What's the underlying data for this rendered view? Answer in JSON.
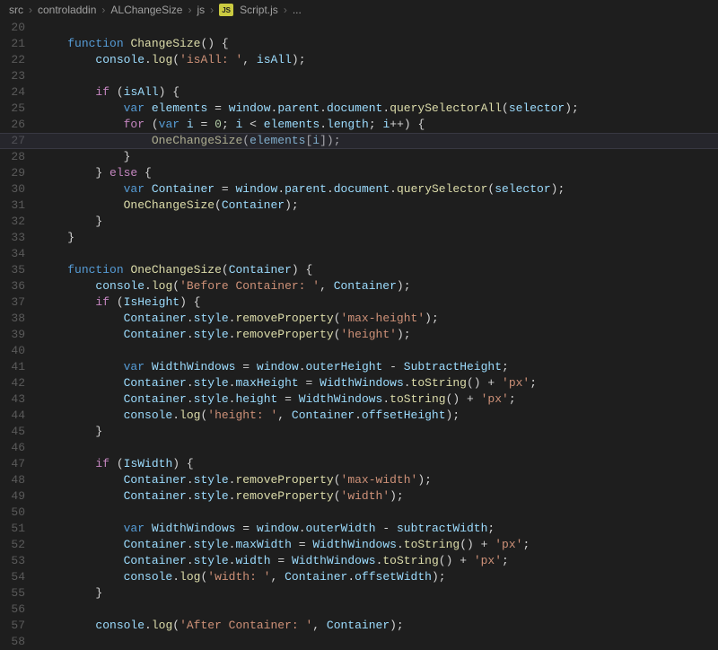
{
  "breadcrumb": {
    "parts": [
      "src",
      "controladdin",
      "ALChangeSize",
      "js"
    ],
    "filename": "Script.js",
    "tail": "...",
    "js_badge": "JS"
  },
  "editor": {
    "first_line": 20,
    "active_line": 27,
    "lines": [
      {
        "n": 20,
        "ind": 0,
        "t": []
      },
      {
        "n": 21,
        "ind": 1,
        "t": [
          [
            "kw",
            "function"
          ],
          [
            "sp",
            " "
          ],
          [
            "fn",
            "ChangeSize"
          ],
          [
            "pun",
            "() {"
          ]
        ]
      },
      {
        "n": 22,
        "ind": 2,
        "t": [
          [
            "var",
            "console"
          ],
          [
            "pun",
            "."
          ],
          [
            "fn",
            "log"
          ],
          [
            "pun",
            "("
          ],
          [
            "str",
            "'isAll: '"
          ],
          [
            "pun",
            ", "
          ],
          [
            "var",
            "isAll"
          ],
          [
            "pun",
            ");"
          ]
        ]
      },
      {
        "n": 23,
        "ind": 0,
        "t": []
      },
      {
        "n": 24,
        "ind": 2,
        "t": [
          [
            "ctrl",
            "if"
          ],
          [
            "sp",
            " "
          ],
          [
            "pun",
            "("
          ],
          [
            "var",
            "isAll"
          ],
          [
            "pun",
            ") {"
          ]
        ]
      },
      {
        "n": 25,
        "ind": 3,
        "t": [
          [
            "kw",
            "var"
          ],
          [
            "sp",
            " "
          ],
          [
            "var",
            "elements"
          ],
          [
            "sp",
            " "
          ],
          [
            "op",
            "="
          ],
          [
            "sp",
            " "
          ],
          [
            "var",
            "window"
          ],
          [
            "pun",
            "."
          ],
          [
            "prop",
            "parent"
          ],
          [
            "pun",
            "."
          ],
          [
            "prop",
            "document"
          ],
          [
            "pun",
            "."
          ],
          [
            "fn",
            "querySelectorAll"
          ],
          [
            "pun",
            "("
          ],
          [
            "var",
            "selector"
          ],
          [
            "pun",
            ");"
          ]
        ]
      },
      {
        "n": 26,
        "ind": 3,
        "t": [
          [
            "ctrl",
            "for"
          ],
          [
            "sp",
            " "
          ],
          [
            "pun",
            "("
          ],
          [
            "kw",
            "var"
          ],
          [
            "sp",
            " "
          ],
          [
            "var",
            "i"
          ],
          [
            "sp",
            " "
          ],
          [
            "op",
            "="
          ],
          [
            "sp",
            " "
          ],
          [
            "num",
            "0"
          ],
          [
            "pun",
            "; "
          ],
          [
            "var",
            "i"
          ],
          [
            "sp",
            " "
          ],
          [
            "op",
            "<"
          ],
          [
            "sp",
            " "
          ],
          [
            "var",
            "elements"
          ],
          [
            "pun",
            "."
          ],
          [
            "prop",
            "length"
          ],
          [
            "pun",
            "; "
          ],
          [
            "var",
            "i"
          ],
          [
            "op",
            "++"
          ],
          [
            "pun",
            ") {"
          ]
        ]
      },
      {
        "n": 27,
        "ind": 4,
        "t": [
          [
            "fn",
            "OneChangeSize"
          ],
          [
            "pun",
            "("
          ],
          [
            "var",
            "elements"
          ],
          [
            "pun",
            "["
          ],
          [
            "var",
            "i"
          ],
          [
            "pun",
            "]);"
          ]
        ]
      },
      {
        "n": 28,
        "ind": 3,
        "t": [
          [
            "pun",
            "}"
          ]
        ]
      },
      {
        "n": 29,
        "ind": 2,
        "t": [
          [
            "pun",
            "} "
          ],
          [
            "ctrl",
            "else"
          ],
          [
            "pun",
            " {"
          ]
        ]
      },
      {
        "n": 30,
        "ind": 3,
        "t": [
          [
            "kw",
            "var"
          ],
          [
            "sp",
            " "
          ],
          [
            "var",
            "Container"
          ],
          [
            "sp",
            " "
          ],
          [
            "op",
            "="
          ],
          [
            "sp",
            " "
          ],
          [
            "var",
            "window"
          ],
          [
            "pun",
            "."
          ],
          [
            "prop",
            "parent"
          ],
          [
            "pun",
            "."
          ],
          [
            "prop",
            "document"
          ],
          [
            "pun",
            "."
          ],
          [
            "fn",
            "querySelector"
          ],
          [
            "pun",
            "("
          ],
          [
            "var",
            "selector"
          ],
          [
            "pun",
            ");"
          ]
        ]
      },
      {
        "n": 31,
        "ind": 3,
        "t": [
          [
            "fn",
            "OneChangeSize"
          ],
          [
            "pun",
            "("
          ],
          [
            "var",
            "Container"
          ],
          [
            "pun",
            ");"
          ]
        ]
      },
      {
        "n": 32,
        "ind": 2,
        "t": [
          [
            "pun",
            "}"
          ]
        ]
      },
      {
        "n": 33,
        "ind": 1,
        "t": [
          [
            "pun",
            "}"
          ]
        ]
      },
      {
        "n": 34,
        "ind": 0,
        "t": []
      },
      {
        "n": 35,
        "ind": 1,
        "t": [
          [
            "kw",
            "function"
          ],
          [
            "sp",
            " "
          ],
          [
            "fn",
            "OneChangeSize"
          ],
          [
            "pun",
            "("
          ],
          [
            "var",
            "Container"
          ],
          [
            "pun",
            ") {"
          ]
        ]
      },
      {
        "n": 36,
        "ind": 2,
        "t": [
          [
            "var",
            "console"
          ],
          [
            "pun",
            "."
          ],
          [
            "fn",
            "log"
          ],
          [
            "pun",
            "("
          ],
          [
            "str",
            "'Before Container: '"
          ],
          [
            "pun",
            ", "
          ],
          [
            "var",
            "Container"
          ],
          [
            "pun",
            ");"
          ]
        ]
      },
      {
        "n": 37,
        "ind": 2,
        "t": [
          [
            "ctrl",
            "if"
          ],
          [
            "sp",
            " "
          ],
          [
            "pun",
            "("
          ],
          [
            "var",
            "IsHeight"
          ],
          [
            "pun",
            ") {"
          ]
        ]
      },
      {
        "n": 38,
        "ind": 3,
        "t": [
          [
            "var",
            "Container"
          ],
          [
            "pun",
            "."
          ],
          [
            "prop",
            "style"
          ],
          [
            "pun",
            "."
          ],
          [
            "fn",
            "removeProperty"
          ],
          [
            "pun",
            "("
          ],
          [
            "str",
            "'max-height'"
          ],
          [
            "pun",
            ");"
          ]
        ]
      },
      {
        "n": 39,
        "ind": 3,
        "t": [
          [
            "var",
            "Container"
          ],
          [
            "pun",
            "."
          ],
          [
            "prop",
            "style"
          ],
          [
            "pun",
            "."
          ],
          [
            "fn",
            "removeProperty"
          ],
          [
            "pun",
            "("
          ],
          [
            "str",
            "'height'"
          ],
          [
            "pun",
            ");"
          ]
        ]
      },
      {
        "n": 40,
        "ind": 0,
        "t": []
      },
      {
        "n": 41,
        "ind": 3,
        "t": [
          [
            "kw",
            "var"
          ],
          [
            "sp",
            " "
          ],
          [
            "var",
            "WidthWindows"
          ],
          [
            "sp",
            " "
          ],
          [
            "op",
            "="
          ],
          [
            "sp",
            " "
          ],
          [
            "var",
            "window"
          ],
          [
            "pun",
            "."
          ],
          [
            "prop",
            "outerHeight"
          ],
          [
            "sp",
            " "
          ],
          [
            "op",
            "-"
          ],
          [
            "sp",
            " "
          ],
          [
            "var",
            "SubtractHeight"
          ],
          [
            "pun",
            ";"
          ]
        ]
      },
      {
        "n": 42,
        "ind": 3,
        "t": [
          [
            "var",
            "Container"
          ],
          [
            "pun",
            "."
          ],
          [
            "prop",
            "style"
          ],
          [
            "pun",
            "."
          ],
          [
            "prop",
            "maxHeight"
          ],
          [
            "sp",
            " "
          ],
          [
            "op",
            "="
          ],
          [
            "sp",
            " "
          ],
          [
            "var",
            "WidthWindows"
          ],
          [
            "pun",
            "."
          ],
          [
            "fn",
            "toString"
          ],
          [
            "pun",
            "() "
          ],
          [
            "op",
            "+"
          ],
          [
            "sp",
            " "
          ],
          [
            "str",
            "'px'"
          ],
          [
            "pun",
            ";"
          ]
        ]
      },
      {
        "n": 43,
        "ind": 3,
        "t": [
          [
            "var",
            "Container"
          ],
          [
            "pun",
            "."
          ],
          [
            "prop",
            "style"
          ],
          [
            "pun",
            "."
          ],
          [
            "prop",
            "height"
          ],
          [
            "sp",
            " "
          ],
          [
            "op",
            "="
          ],
          [
            "sp",
            " "
          ],
          [
            "var",
            "WidthWindows"
          ],
          [
            "pun",
            "."
          ],
          [
            "fn",
            "toString"
          ],
          [
            "pun",
            "() "
          ],
          [
            "op",
            "+"
          ],
          [
            "sp",
            " "
          ],
          [
            "str",
            "'px'"
          ],
          [
            "pun",
            ";"
          ]
        ]
      },
      {
        "n": 44,
        "ind": 3,
        "t": [
          [
            "var",
            "console"
          ],
          [
            "pun",
            "."
          ],
          [
            "fn",
            "log"
          ],
          [
            "pun",
            "("
          ],
          [
            "str",
            "'height: '"
          ],
          [
            "pun",
            ", "
          ],
          [
            "var",
            "Container"
          ],
          [
            "pun",
            "."
          ],
          [
            "prop",
            "offsetHeight"
          ],
          [
            "pun",
            ");"
          ]
        ]
      },
      {
        "n": 45,
        "ind": 2,
        "t": [
          [
            "pun",
            "}"
          ]
        ]
      },
      {
        "n": 46,
        "ind": 0,
        "t": []
      },
      {
        "n": 47,
        "ind": 2,
        "t": [
          [
            "ctrl",
            "if"
          ],
          [
            "sp",
            " "
          ],
          [
            "pun",
            "("
          ],
          [
            "var",
            "IsWidth"
          ],
          [
            "pun",
            ") {"
          ]
        ]
      },
      {
        "n": 48,
        "ind": 3,
        "t": [
          [
            "var",
            "Container"
          ],
          [
            "pun",
            "."
          ],
          [
            "prop",
            "style"
          ],
          [
            "pun",
            "."
          ],
          [
            "fn",
            "removeProperty"
          ],
          [
            "pun",
            "("
          ],
          [
            "str",
            "'max-width'"
          ],
          [
            "pun",
            ");"
          ]
        ]
      },
      {
        "n": 49,
        "ind": 3,
        "t": [
          [
            "var",
            "Container"
          ],
          [
            "pun",
            "."
          ],
          [
            "prop",
            "style"
          ],
          [
            "pun",
            "."
          ],
          [
            "fn",
            "removeProperty"
          ],
          [
            "pun",
            "("
          ],
          [
            "str",
            "'width'"
          ],
          [
            "pun",
            ");"
          ]
        ]
      },
      {
        "n": 50,
        "ind": 0,
        "t": []
      },
      {
        "n": 51,
        "ind": 3,
        "t": [
          [
            "kw",
            "var"
          ],
          [
            "sp",
            " "
          ],
          [
            "var",
            "WidthWindows"
          ],
          [
            "sp",
            " "
          ],
          [
            "op",
            "="
          ],
          [
            "sp",
            " "
          ],
          [
            "var",
            "window"
          ],
          [
            "pun",
            "."
          ],
          [
            "prop",
            "outerWidth"
          ],
          [
            "sp",
            " "
          ],
          [
            "op",
            "-"
          ],
          [
            "sp",
            " "
          ],
          [
            "var",
            "subtractWidth"
          ],
          [
            "pun",
            ";"
          ]
        ]
      },
      {
        "n": 52,
        "ind": 3,
        "t": [
          [
            "var",
            "Container"
          ],
          [
            "pun",
            "."
          ],
          [
            "prop",
            "style"
          ],
          [
            "pun",
            "."
          ],
          [
            "prop",
            "maxWidth"
          ],
          [
            "sp",
            " "
          ],
          [
            "op",
            "="
          ],
          [
            "sp",
            " "
          ],
          [
            "var",
            "WidthWindows"
          ],
          [
            "pun",
            "."
          ],
          [
            "fn",
            "toString"
          ],
          [
            "pun",
            "() "
          ],
          [
            "op",
            "+"
          ],
          [
            "sp",
            " "
          ],
          [
            "str",
            "'px'"
          ],
          [
            "pun",
            ";"
          ]
        ]
      },
      {
        "n": 53,
        "ind": 3,
        "t": [
          [
            "var",
            "Container"
          ],
          [
            "pun",
            "."
          ],
          [
            "prop",
            "style"
          ],
          [
            "pun",
            "."
          ],
          [
            "prop",
            "width"
          ],
          [
            "sp",
            " "
          ],
          [
            "op",
            "="
          ],
          [
            "sp",
            " "
          ],
          [
            "var",
            "WidthWindows"
          ],
          [
            "pun",
            "."
          ],
          [
            "fn",
            "toString"
          ],
          [
            "pun",
            "() "
          ],
          [
            "op",
            "+"
          ],
          [
            "sp",
            " "
          ],
          [
            "str",
            "'px'"
          ],
          [
            "pun",
            ";"
          ]
        ]
      },
      {
        "n": 54,
        "ind": 3,
        "t": [
          [
            "var",
            "console"
          ],
          [
            "pun",
            "."
          ],
          [
            "fn",
            "log"
          ],
          [
            "pun",
            "("
          ],
          [
            "str",
            "'width: '"
          ],
          [
            "pun",
            ", "
          ],
          [
            "var",
            "Container"
          ],
          [
            "pun",
            "."
          ],
          [
            "prop",
            "offsetWidth"
          ],
          [
            "pun",
            ");"
          ]
        ]
      },
      {
        "n": 55,
        "ind": 2,
        "t": [
          [
            "pun",
            "}"
          ]
        ]
      },
      {
        "n": 56,
        "ind": 0,
        "t": []
      },
      {
        "n": 57,
        "ind": 2,
        "t": [
          [
            "var",
            "console"
          ],
          [
            "pun",
            "."
          ],
          [
            "fn",
            "log"
          ],
          [
            "pun",
            "("
          ],
          [
            "str",
            "'After Container: '"
          ],
          [
            "pun",
            ", "
          ],
          [
            "var",
            "Container"
          ],
          [
            "pun",
            ");"
          ]
        ]
      },
      {
        "n": 58,
        "ind": 0,
        "t": []
      }
    ]
  }
}
